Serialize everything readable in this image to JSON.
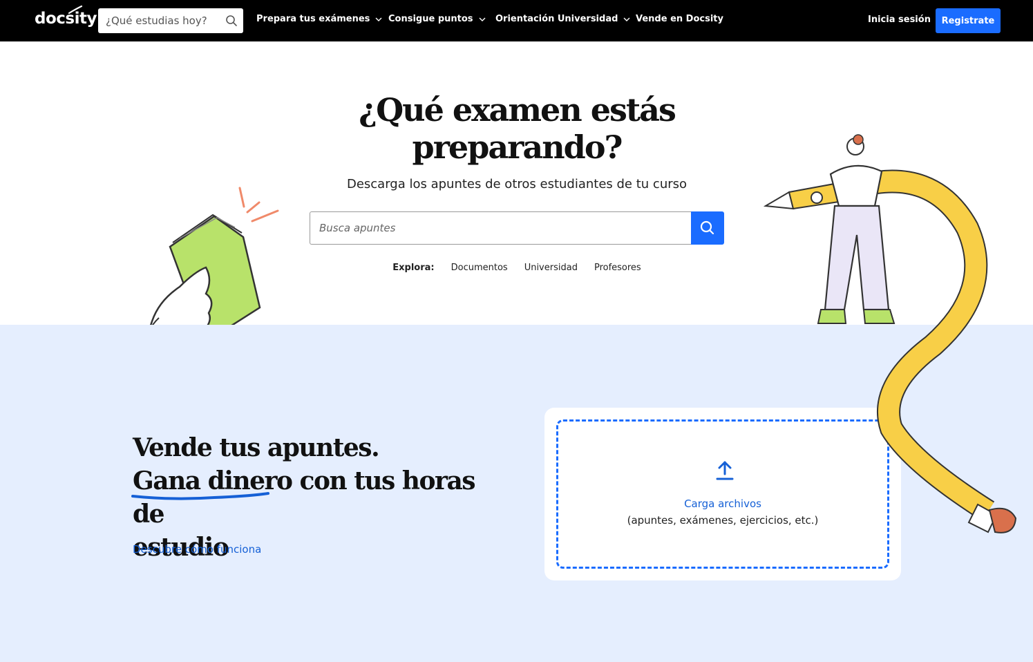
{
  "brand": {
    "logo_text": "docsity"
  },
  "nav": {
    "search_placeholder": "¿Qué estudias hoy?",
    "items": [
      {
        "label": "Prepara tus exámenes"
      },
      {
        "label": "Consigue puntos"
      },
      {
        "label": "Orientación Universidad"
      },
      {
        "label": "Vende en Docsity"
      }
    ],
    "login_label": "Inicia sesión",
    "register_label": "Registrate"
  },
  "hero": {
    "title_line1": "¿Qué examen estás",
    "title_line2": "preparando?",
    "subtitle": "Descarga los apuntes de otros estudiantes de tu curso",
    "search_placeholder": "Busca apuntes",
    "explore_label": "Explora:",
    "explore_links": [
      {
        "label": "Documentos"
      },
      {
        "label": "Universidad"
      },
      {
        "label": "Profesores"
      }
    ]
  },
  "sell": {
    "title_line1": "Vende tus apuntes.",
    "title_highlight": "Gana dinero",
    "title_line2_rest": " con tus horas de",
    "title_line3": "estudio",
    "link": "Descubre cómo funciona",
    "upload_label": "Carga archivos",
    "upload_hint": "(apuntes, exámenes, ejercicios, etc.)"
  },
  "colors": {
    "topbar_bg": "#000000",
    "accent_blue": "#1a6cff",
    "link_blue": "#1560d6",
    "sell_bg": "#e5eefe",
    "pencil_yellow": "#f8cf47",
    "book_green": "#b8e26a"
  },
  "icons": {
    "nav_search": "search-icon",
    "nav_chevron": "chevron-down-icon",
    "hero_search": "search-icon",
    "upload": "upload-icon"
  }
}
